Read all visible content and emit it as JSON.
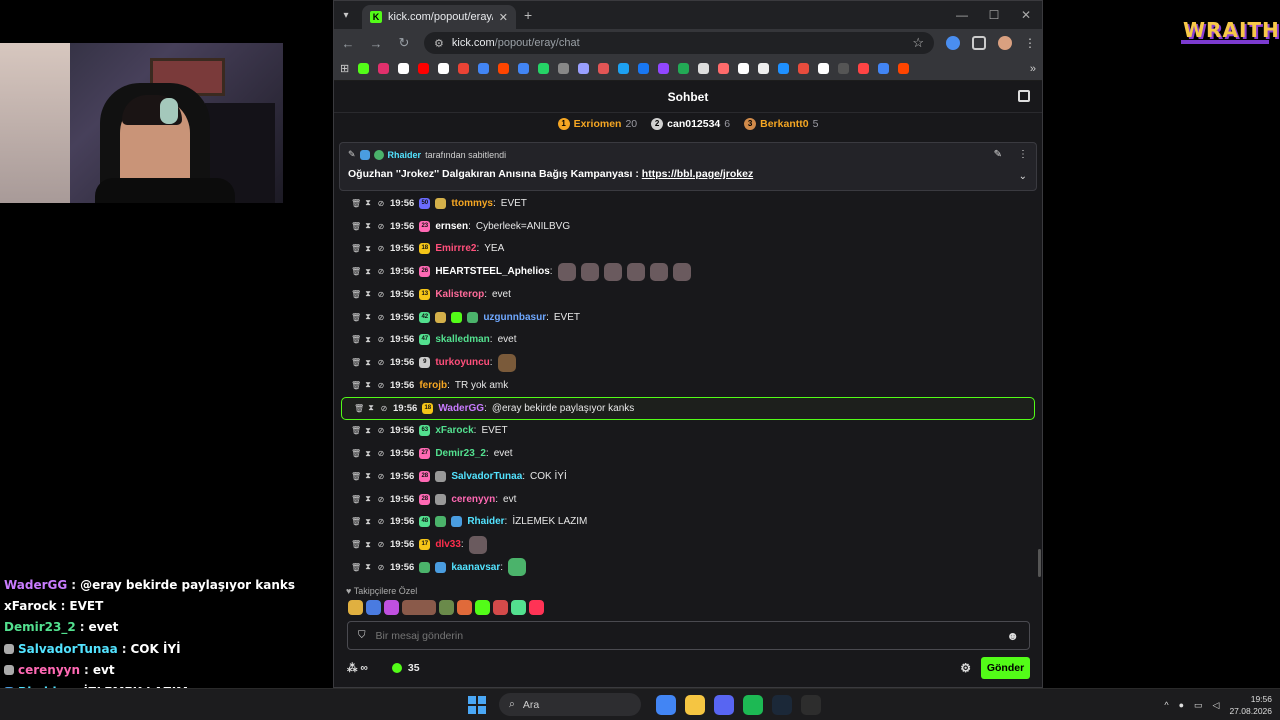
{
  "overlay": {
    "brand_logo": "WRAITH.",
    "chat": [
      {
        "user": "WaderGG",
        "sep": ":",
        "text": "@eray bekirde paylaşıyor kanks",
        "color": "#c97cff",
        "badge": ""
      },
      {
        "user": "xFarock",
        "sep": ":",
        "text": "EVET",
        "color": "#ffffff",
        "badge": ""
      },
      {
        "user": "Demir23_2",
        "sep": ":",
        "text": "evet",
        "color": "#53e08f",
        "badge": ""
      },
      {
        "user": "SalvadorTunaa",
        "sep": ":",
        "text": "COK İYİ",
        "color": "#53e3ff",
        "badge": "#aaaaaa"
      },
      {
        "user": "cerenyyn",
        "sep": ":",
        "text": "evt",
        "color": "#ff69b4",
        "badge": "#aaaaaa"
      },
      {
        "user": "Rhaider",
        "sep": ":",
        "text": "İZLEMEK LAZIM",
        "color": "#53e3ff",
        "badge": "#4a9de0"
      },
      {
        "user": "dlv33",
        "sep": ":",
        "text": "",
        "color": "#ff2e4d",
        "badge": ""
      }
    ]
  },
  "browser": {
    "tab_title": "kick.com/popout/eray/chat",
    "tab_favicon": "K",
    "url_host": "kick.com",
    "url_path": "/popout/eray/chat",
    "bookmark_colors": [
      "#53fc18",
      "#e1306c",
      "#ffffff",
      "#ff0000",
      "#ffffff",
      "#ea4335",
      "#4285f4",
      "#ff4500",
      "#4285f4",
      "#25d366",
      "#888888",
      "#9aa0ff",
      "#e25555",
      "#1da1f2",
      "#1877f2",
      "#9146ff",
      "#22aa55",
      "#dddddd",
      "#ff6b6b",
      "#ffffff",
      "#eeeeee",
      "#1e90ff",
      "#e84c3d",
      "#ffffff",
      "#555555",
      "#ff4444",
      "#4285f4",
      "#ff4500"
    ]
  },
  "chat": {
    "header_title": "Sohbet",
    "leaderboard": [
      {
        "rank": "1",
        "name": "Exriomen",
        "count": "20",
        "color": "#f5a623",
        "name_color": "#f5a623"
      },
      {
        "rank": "2",
        "name": "can012534",
        "count": "6",
        "color": "#d0d0d0",
        "name_color": "#ffffff"
      },
      {
        "rank": "3",
        "name": "Berkantt0",
        "count": "5",
        "color": "#d08a4a",
        "name_color": "#f5a623"
      }
    ],
    "pinned": {
      "by_user": "Rhaider",
      "by_text": "tarafından sabitlendi",
      "message": "Oğuzhan ''Jrokez'' Dalgakıran Anısına Bağış Kampanyası :",
      "link": "https://bbl.page/jrokez"
    },
    "messages": [
      {
        "time": "19:56",
        "badges": [
          {
            "t": "50",
            "c": "#6b6bff"
          },
          {
            "t": "",
            "c": "#d4b04a"
          }
        ],
        "user": "ttommys",
        "color": "#f5a623",
        "text": "EVET",
        "emotes": 0,
        "highlight": false
      },
      {
        "time": "19:56",
        "badges": [
          {
            "t": "23",
            "c": "#ff69b4"
          }
        ],
        "user": "ernsen",
        "color": "#ffffff",
        "text": "Cyberleek=ANILBVG",
        "emotes": 0,
        "highlight": false
      },
      {
        "time": "19:56",
        "badges": [
          {
            "t": "18",
            "c": "#f5c518"
          }
        ],
        "user": "Emirrre2",
        "color": "#ff4f7b",
        "text": "YEA",
        "emotes": 0,
        "highlight": false
      },
      {
        "time": "19:56",
        "badges": [
          {
            "t": "26",
            "c": "#ff69b4"
          }
        ],
        "user": "HEARTSTEEL_Aphelios",
        "color": "#ffffff",
        "text": "",
        "emotes": 6,
        "highlight": false
      },
      {
        "time": "19:56",
        "badges": [
          {
            "t": "13",
            "c": "#f5c518"
          }
        ],
        "user": "Kalisterop",
        "color": "#ff6b9a",
        "text": "evet",
        "emotes": 0,
        "highlight": false
      },
      {
        "time": "19:56",
        "badges": [
          {
            "t": "42",
            "c": "#53e08f"
          },
          {
            "t": "",
            "c": "#d4b04a"
          },
          {
            "t": "",
            "c": "#53fc18"
          },
          {
            "t": "",
            "c": "#4bb36b"
          }
        ],
        "user": "uzgunnbasur",
        "color": "#6fa8ff",
        "text": "EVET",
        "emotes": 0,
        "highlight": false
      },
      {
        "time": "19:56",
        "badges": [
          {
            "t": "47",
            "c": "#53e08f"
          }
        ],
        "user": "skalledman",
        "color": "#53e08f",
        "text": "evet",
        "emotes": 0,
        "highlight": false
      },
      {
        "time": "19:56",
        "badges": [
          {
            "t": "9",
            "c": "#cccccc"
          }
        ],
        "user": "turkoyuncu",
        "color": "#ff4f7b",
        "text": "",
        "emotes": 1,
        "highlight": false
      },
      {
        "time": "19:56",
        "badges": [],
        "user": "ferojb",
        "color": "#f5a623",
        "text": "TR yok amk",
        "emotes": 0,
        "highlight": false
      },
      {
        "time": "19:56",
        "badges": [
          {
            "t": "18",
            "c": "#f5c518"
          }
        ],
        "user": "WaderGG",
        "color": "#c97cff",
        "text": "@eray bekirde paylaşıyor kanks",
        "emotes": 0,
        "highlight": true
      },
      {
        "time": "19:56",
        "badges": [
          {
            "t": "63",
            "c": "#53e08f"
          }
        ],
        "user": "xFarock",
        "color": "#53e08f",
        "text": "EVET",
        "emotes": 0,
        "highlight": false
      },
      {
        "time": "19:56",
        "badges": [
          {
            "t": "27",
            "c": "#ff69b4"
          }
        ],
        "user": "Demir23_2",
        "color": "#53e08f",
        "text": "evet",
        "emotes": 0,
        "highlight": false
      },
      {
        "time": "19:56",
        "badges": [
          {
            "t": "28",
            "c": "#ff69b4"
          },
          {
            "t": "",
            "c": "#999999"
          }
        ],
        "user": "SalvadorTunaa",
        "color": "#53e3ff",
        "text": "COK İYİ",
        "emotes": 0,
        "highlight": false
      },
      {
        "time": "19:56",
        "badges": [
          {
            "t": "28",
            "c": "#ff69b4"
          },
          {
            "t": "",
            "c": "#999999"
          }
        ],
        "user": "cerenyyn",
        "color": "#ff69b4",
        "text": "evt",
        "emotes": 0,
        "highlight": false
      },
      {
        "time": "19:56",
        "badges": [
          {
            "t": "48",
            "c": "#53e08f"
          },
          {
            "t": "",
            "c": "#4bb36b"
          },
          {
            "t": "",
            "c": "#4a9de0"
          }
        ],
        "user": "Rhaider",
        "color": "#53e3ff",
        "text": "İZLEMEK LAZIM",
        "emotes": 0,
        "highlight": false
      },
      {
        "time": "19:56",
        "badges": [
          {
            "t": "17",
            "c": "#f5c518"
          }
        ],
        "user": "dlv33",
        "color": "#ff2e4d",
        "text": "",
        "emotes": 1,
        "highlight": false
      },
      {
        "time": "19:56",
        "badges": [
          {
            "t": "",
            "c": "#4bb36b"
          },
          {
            "t": "",
            "c": "#4a9de0"
          }
        ],
        "user": "kaanavsar",
        "color": "#53e3ff",
        "text": "",
        "emotes": 1,
        "highlight": false
      }
    ],
    "followers_label": "Takipçilere Özel",
    "emote_colors": [
      "#e0b040",
      "#4a7be0",
      "#c050e0",
      "#8a5a4a",
      "#6a8a4a",
      "#e06a3a",
      "#53fc18",
      "#d44a4a",
      "#53e08f",
      "#ff3355"
    ],
    "input_placeholder": "Bir mesaj gönderin",
    "viewers_symbol": "∞",
    "points": "35",
    "send_label": "Gönder"
  },
  "taskbar": {
    "search_label": "Ara",
    "apps": [
      "#4285f4",
      "#f5c542",
      "#5865f2",
      "#1db954",
      "#1b2838",
      "#2d2d2d"
    ],
    "time": "19:56",
    "date": "27.08.2026"
  }
}
